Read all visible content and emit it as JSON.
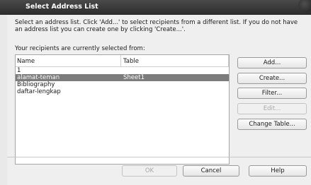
{
  "window": {
    "title": "Select Address List"
  },
  "description": "Select an address list. Click 'Add...' to select recipients from a different list. If you do not have an address list you can create one by clicking 'Create...'.",
  "sublabel": "Your recipients are currently selected from:",
  "list": {
    "headers": [
      "Name",
      "Table"
    ],
    "rows": [
      {
        "name": "1",
        "table": ""
      },
      {
        "name": "alamat-teman",
        "table": "Sheet1",
        "selected": true
      },
      {
        "name": "Bibliography",
        "table": ""
      },
      {
        "name": "daftar-lengkap",
        "table": ""
      }
    ]
  },
  "buttons": {
    "add": "Add...",
    "create": "Create...",
    "filter": "Filter...",
    "edit": "Edit...",
    "change_table": "Change Table...",
    "ok": "OK",
    "cancel": "Cancel",
    "help": "Help"
  },
  "colors": {
    "selection": "#7c7c7c",
    "titlebar": "#2c2c2c"
  }
}
